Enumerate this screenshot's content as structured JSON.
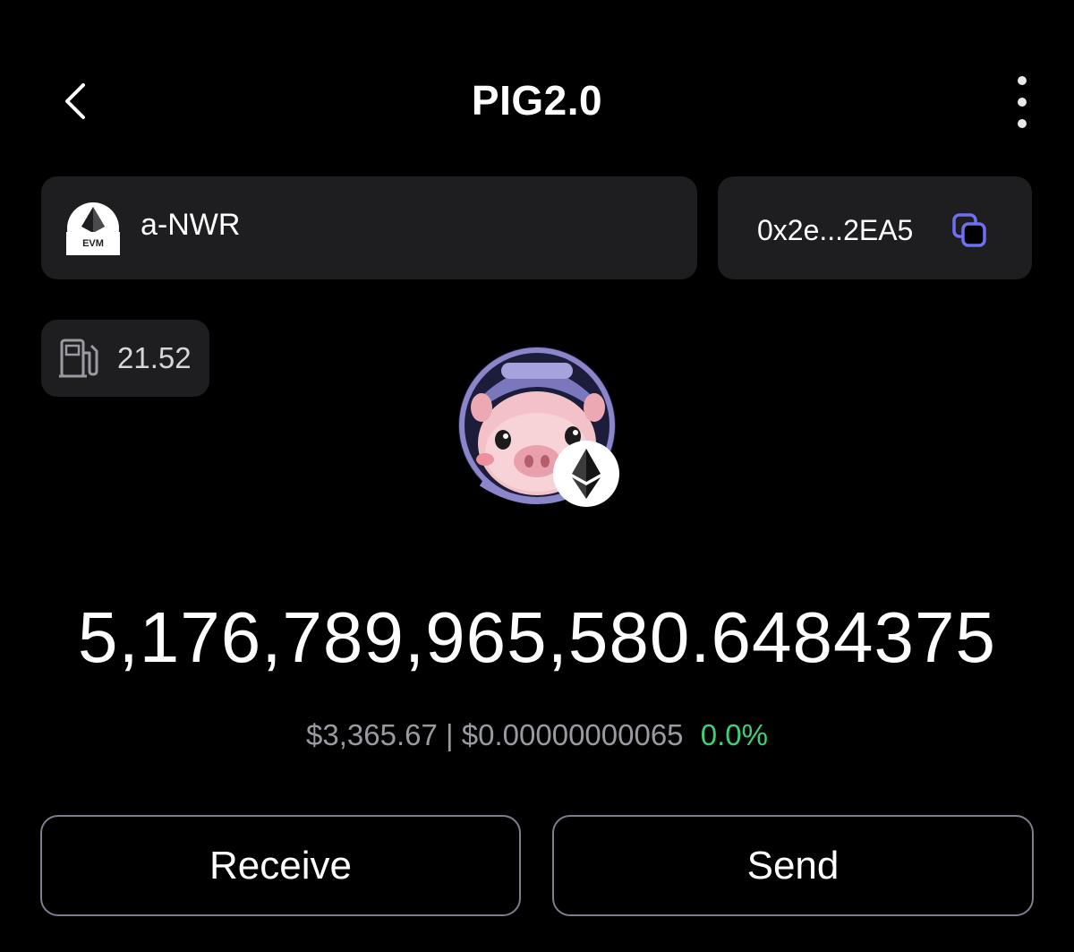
{
  "header": {
    "title": "PIG2.0",
    "back_icon": "chevron-left-icon",
    "menu_icon": "vertical-dots-icon"
  },
  "wallet": {
    "chain_badge_label": "EVM",
    "name": "a-NWR",
    "address_short": "0x2e...2EA5",
    "copy_icon": "copy-icon"
  },
  "gas": {
    "icon": "fuel-pump-icon",
    "value": "21.52"
  },
  "token": {
    "logo": "pig-astronaut-token-logo",
    "network_badge_icon": "ethereum-icon",
    "balance": "5,176,789,965,580.6484375",
    "value_usd": "$3,365.67",
    "separator": "|",
    "price_usd": "$0.00000000065",
    "change_24h": "0.0%"
  },
  "actions": {
    "receive_label": "Receive",
    "send_label": "Send"
  },
  "colors": {
    "background": "#000000",
    "card": "#1e1e20",
    "accent": "#6f6ff2",
    "positive": "#3fcf7a",
    "muted_text": "#9a9aa2",
    "button_border": "#7d7d8e"
  }
}
